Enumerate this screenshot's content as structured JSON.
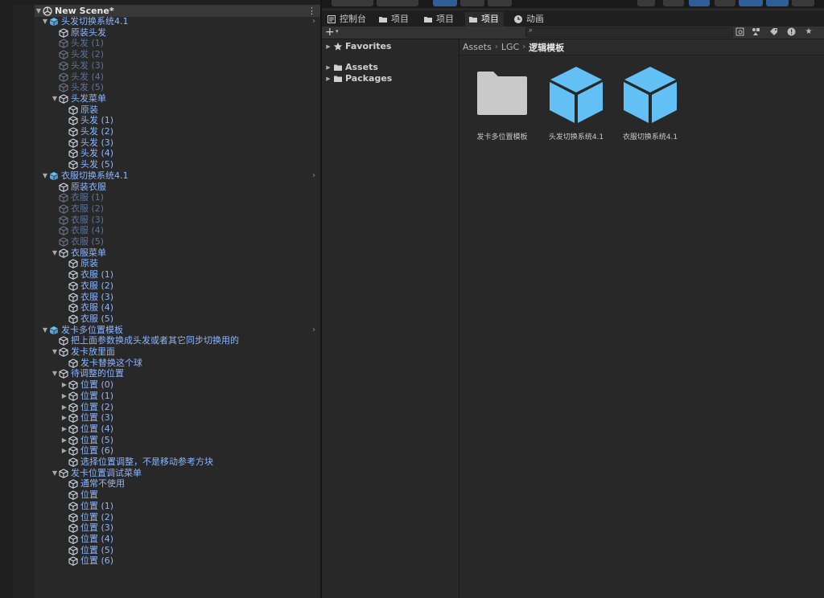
{
  "hierarchy": {
    "scene_name": "New Scene*",
    "menu_glyph": "⋮",
    "rows": [
      {
        "label": "头发切换系统4.1",
        "indent": 1,
        "arrow": "▼",
        "icon": "prefab-icon",
        "style": "c-blue",
        "chevron": true
      },
      {
        "label": "原装头发",
        "indent": 2,
        "arrow": "",
        "icon": "gameobject-icon",
        "style": "c-blue"
      },
      {
        "label": "头发 (1)",
        "indent": 2,
        "arrow": "",
        "icon": "gameobject-icon",
        "style": "c-dim"
      },
      {
        "label": "头发 (2)",
        "indent": 2,
        "arrow": "",
        "icon": "gameobject-icon",
        "style": "c-dim"
      },
      {
        "label": "头发 (3)",
        "indent": 2,
        "arrow": "",
        "icon": "gameobject-icon",
        "style": "c-dim"
      },
      {
        "label": "头发 (4)",
        "indent": 2,
        "arrow": "",
        "icon": "gameobject-icon",
        "style": "c-dim"
      },
      {
        "label": "头发 (5)",
        "indent": 2,
        "arrow": "",
        "icon": "gameobject-icon",
        "style": "c-dim"
      },
      {
        "label": "头发菜单",
        "indent": 2,
        "arrow": "▼",
        "icon": "gameobject-icon",
        "style": "c-blue"
      },
      {
        "label": "原装",
        "indent": 3,
        "arrow": "",
        "icon": "gameobject-icon",
        "style": "c-blue"
      },
      {
        "label": "头发 (1)",
        "indent": 3,
        "arrow": "",
        "icon": "gameobject-icon",
        "style": "c-blue"
      },
      {
        "label": "头发 (2)",
        "indent": 3,
        "arrow": "",
        "icon": "gameobject-icon",
        "style": "c-blue"
      },
      {
        "label": "头发 (3)",
        "indent": 3,
        "arrow": "",
        "icon": "gameobject-icon",
        "style": "c-blue"
      },
      {
        "label": "头发 (4)",
        "indent": 3,
        "arrow": "",
        "icon": "gameobject-icon",
        "style": "c-blue"
      },
      {
        "label": "头发 (5)",
        "indent": 3,
        "arrow": "",
        "icon": "gameobject-icon",
        "style": "c-blue"
      },
      {
        "label": "衣服切换系统4.1",
        "indent": 1,
        "arrow": "▼",
        "icon": "prefab-icon",
        "style": "c-blue",
        "chevron": true
      },
      {
        "label": "原装衣服",
        "indent": 2,
        "arrow": "",
        "icon": "gameobject-icon",
        "style": "c-blue"
      },
      {
        "label": "衣服 (1)",
        "indent": 2,
        "arrow": "",
        "icon": "gameobject-icon",
        "style": "c-dim"
      },
      {
        "label": "衣服 (2)",
        "indent": 2,
        "arrow": "",
        "icon": "gameobject-icon",
        "style": "c-dim"
      },
      {
        "label": "衣服 (3)",
        "indent": 2,
        "arrow": "",
        "icon": "gameobject-icon",
        "style": "c-dim"
      },
      {
        "label": "衣服 (4)",
        "indent": 2,
        "arrow": "",
        "icon": "gameobject-icon",
        "style": "c-dim"
      },
      {
        "label": "衣服 (5)",
        "indent": 2,
        "arrow": "",
        "icon": "gameobject-icon",
        "style": "c-dim"
      },
      {
        "label": "衣服菜单",
        "indent": 2,
        "arrow": "▼",
        "icon": "gameobject-icon",
        "style": "c-blue"
      },
      {
        "label": "原装",
        "indent": 3,
        "arrow": "",
        "icon": "gameobject-icon",
        "style": "c-blue"
      },
      {
        "label": "衣服 (1)",
        "indent": 3,
        "arrow": "",
        "icon": "gameobject-icon",
        "style": "c-blue"
      },
      {
        "label": "衣服 (2)",
        "indent": 3,
        "arrow": "",
        "icon": "gameobject-icon",
        "style": "c-blue"
      },
      {
        "label": "衣服 (3)",
        "indent": 3,
        "arrow": "",
        "icon": "gameobject-icon",
        "style": "c-blue"
      },
      {
        "label": "衣服 (4)",
        "indent": 3,
        "arrow": "",
        "icon": "gameobject-icon",
        "style": "c-blue"
      },
      {
        "label": "衣服 (5)",
        "indent": 3,
        "arrow": "",
        "icon": "gameobject-icon",
        "style": "c-blue"
      },
      {
        "label": "发卡多位置模板",
        "indent": 1,
        "arrow": "▼",
        "icon": "prefab-icon",
        "style": "c-blue",
        "chevron": true
      },
      {
        "label": "把上面参数换成头发或者其它同步切换用的",
        "indent": 2,
        "arrow": "",
        "icon": "gameobject-icon",
        "style": "c-blue"
      },
      {
        "label": "发卡放里面",
        "indent": 2,
        "arrow": "▼",
        "icon": "gameobject-icon",
        "style": "c-blue"
      },
      {
        "label": "发卡替换这个球",
        "indent": 3,
        "arrow": "",
        "icon": "gameobject-icon",
        "style": "c-blue"
      },
      {
        "label": "待调整的位置",
        "indent": 2,
        "arrow": "▼",
        "icon": "gameobject-icon",
        "style": "c-blue"
      },
      {
        "label": "位置 (0)",
        "indent": 3,
        "arrow": "▶",
        "icon": "gameobject-icon",
        "style": "c-blue"
      },
      {
        "label": "位置 (1)",
        "indent": 3,
        "arrow": "▶",
        "icon": "gameobject-icon",
        "style": "c-blue"
      },
      {
        "label": "位置 (2)",
        "indent": 3,
        "arrow": "▶",
        "icon": "gameobject-icon",
        "style": "c-blue"
      },
      {
        "label": "位置 (3)",
        "indent": 3,
        "arrow": "▶",
        "icon": "gameobject-icon",
        "style": "c-blue"
      },
      {
        "label": "位置 (4)",
        "indent": 3,
        "arrow": "▶",
        "icon": "gameobject-icon",
        "style": "c-blue"
      },
      {
        "label": "位置 (5)",
        "indent": 3,
        "arrow": "▶",
        "icon": "gameobject-icon",
        "style": "c-blue"
      },
      {
        "label": "位置 (6)",
        "indent": 3,
        "arrow": "▶",
        "icon": "gameobject-icon",
        "style": "c-blue"
      },
      {
        "label": "选择位置调整，不是移动参考方块",
        "indent": 3,
        "arrow": "",
        "icon": "gameobject-icon",
        "style": "c-blue"
      },
      {
        "label": "发卡位置调试菜单",
        "indent": 2,
        "arrow": "▼",
        "icon": "gameobject-icon",
        "style": "c-blue"
      },
      {
        "label": "通常不使用",
        "indent": 3,
        "arrow": "",
        "icon": "gameobject-icon",
        "style": "c-blue"
      },
      {
        "label": "位置",
        "indent": 3,
        "arrow": "",
        "icon": "gameobject-icon",
        "style": "c-blue"
      },
      {
        "label": "位置 (1)",
        "indent": 3,
        "arrow": "",
        "icon": "gameobject-icon",
        "style": "c-blue"
      },
      {
        "label": "位置 (2)",
        "indent": 3,
        "arrow": "",
        "icon": "gameobject-icon",
        "style": "c-blue"
      },
      {
        "label": "位置 (3)",
        "indent": 3,
        "arrow": "",
        "icon": "gameobject-icon",
        "style": "c-blue"
      },
      {
        "label": "位置 (4)",
        "indent": 3,
        "arrow": "",
        "icon": "gameobject-icon",
        "style": "c-blue"
      },
      {
        "label": "位置 (5)",
        "indent": 3,
        "arrow": "",
        "icon": "gameobject-icon",
        "style": "c-blue"
      },
      {
        "label": "位置 (6)",
        "indent": 3,
        "arrow": "",
        "icon": "gameobject-icon",
        "style": "c-blue"
      }
    ]
  },
  "tabs": [
    {
      "label": "控制台",
      "icon": "console-icon",
      "active": false
    },
    {
      "label": "项目",
      "icon": "folder-icon",
      "active": false
    },
    {
      "label": "项目",
      "icon": "folder-icon",
      "active": false
    },
    {
      "label": "项目",
      "icon": "folder-icon",
      "active": true
    },
    {
      "label": "动画",
      "icon": "animation-clock-icon",
      "active": false
    }
  ],
  "project_toolbar": {
    "add_label": "+",
    "add_caret": "▾",
    "search_placeholder": "",
    "search_glyph": "⌕"
  },
  "project_tree": [
    {
      "label": "Favorites",
      "arrow": "▶",
      "icon": "star-icon"
    },
    {
      "label": "Assets",
      "arrow": "▶",
      "icon": "folder-icon"
    },
    {
      "label": "Packages",
      "arrow": "▶",
      "icon": "folder-icon"
    }
  ],
  "breadcrumb": [
    "Assets",
    "LGC",
    "逻辑模板"
  ],
  "breadcrumb_sep": "›",
  "assets": [
    {
      "label": "发卡多位置模板",
      "kind": "folder"
    },
    {
      "label": "头发切换系统4.1",
      "kind": "prefab"
    },
    {
      "label": "衣服切换系统4.1",
      "kind": "prefab"
    }
  ],
  "colors": {
    "prefab_blue": "#62c0f5",
    "text_blue": "#8cb6ff",
    "folder_gray": "#c9c9c9"
  }
}
